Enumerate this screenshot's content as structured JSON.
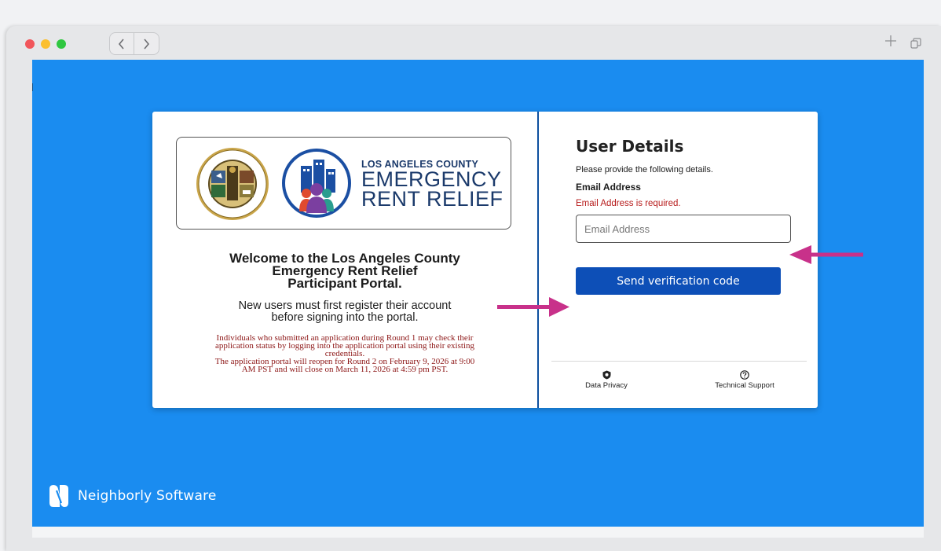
{
  "window": {
    "nav_back_glyph": "‹",
    "nav_forward_glyph": "›",
    "new_tab_glyph": "+",
    "icons": [
      "back-icon",
      "forward-icon",
      "plus-icon",
      "copy-window-icon"
    ]
  },
  "brand": {
    "line1": "LOS ANGELES COUNTY",
    "line2": "EMERGENCY",
    "line3": "RENT RELIEF",
    "seal_top_text": "COUNTY OF LOS ANGELES",
    "seal_bottom_text": "CALIFORNIA"
  },
  "welcome": {
    "line1": "Welcome to the Los Angeles County",
    "line2": "Emergency Rent Relief",
    "line3": "Participant Portal."
  },
  "register": {
    "line1": "New users must first register their account",
    "line2": "before signing into the portal."
  },
  "notice": {
    "line1": "Individuals who submitted an application during Round 1 may check their",
    "line2": "application status by logging into the application portal using their existing",
    "line3": "credentials.",
    "line4": "The application portal will reopen for Round 2 on February 9, 2026 at 9:00",
    "line5": "AM PST and will close on March 11, 2026 at 4:59 pm PST."
  },
  "user_details": {
    "title": "User Details",
    "description": "Please provide the following details.",
    "email_label": "Email Address",
    "email_error": "Email Address is required.",
    "email_value": "",
    "email_placeholder": "Email Address",
    "send_button": "Send verification code"
  },
  "footer": {
    "privacy": "Data Privacy",
    "support": "Technical Support"
  },
  "footer_logo": {
    "text": "Neighborly Software"
  },
  "colors": {
    "viewport_bg": "#1a8cf0",
    "button": "#0d4fb7",
    "error": "#b71c1c",
    "annotation_arrow": "#c8318a"
  }
}
